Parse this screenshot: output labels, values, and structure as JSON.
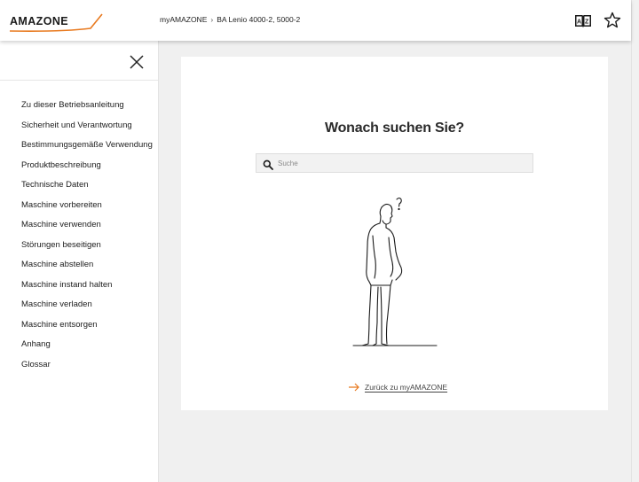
{
  "header": {
    "logo_text": "AMAZONE",
    "breadcrumb": {
      "root": "myAMAZONE",
      "separator": "›",
      "current": "BA Lenio 4000-2, 5000-2"
    },
    "icons": [
      "glossary-icon",
      "star-icon"
    ]
  },
  "sidebar": {
    "close_icon": "close-icon",
    "items": [
      {
        "label": "Zu dieser Betriebsanleitung"
      },
      {
        "label": "Sicherheit und Verantwortung"
      },
      {
        "label": "Bestimmungsgemäße Verwendung"
      },
      {
        "label": "Produktbeschreibung"
      },
      {
        "label": "Technische Daten"
      },
      {
        "label": "Maschine vorbereiten"
      },
      {
        "label": "Maschine verwenden"
      },
      {
        "label": "Störungen beseitigen"
      },
      {
        "label": "Maschine abstellen"
      },
      {
        "label": "Maschine instand halten"
      },
      {
        "label": "Maschine verladen"
      },
      {
        "label": "Maschine entsorgen"
      },
      {
        "label": "Anhang"
      },
      {
        "label": "Glossar"
      }
    ]
  },
  "main": {
    "title": "Wonach suchen Sie?",
    "search": {
      "placeholder": "Suche",
      "value": ""
    },
    "back_link": "Zurück zu myAMAZONE"
  },
  "colors": {
    "accent": "#e8791e",
    "text": "#1a1a1a",
    "background": "#f0f0f0",
    "card": "#ffffff"
  }
}
